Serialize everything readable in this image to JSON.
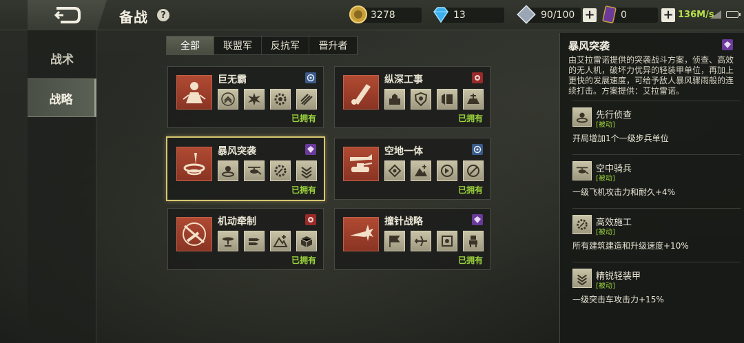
{
  "header": {
    "title": "备战",
    "help": "?",
    "resources": {
      "gold": "3278",
      "diamond": "13",
      "crystal": "90/100",
      "card": "0"
    },
    "net_speed": "136M/s"
  },
  "nav": {
    "items": [
      {
        "label": "战术",
        "active": false
      },
      {
        "label": "战略",
        "active": true
      }
    ]
  },
  "filters": [
    "全部",
    "联盟军",
    "反抗军",
    "晋升者"
  ],
  "owned_label": "已拥有",
  "cards": [
    {
      "name": "巨无霸",
      "faction": "alliance",
      "selected": false
    },
    {
      "name": "纵深工事",
      "faction": "rebel",
      "selected": false
    },
    {
      "name": "暴风突袭",
      "faction": "ascend",
      "selected": true
    },
    {
      "name": "空地一体",
      "faction": "alliance",
      "selected": false
    },
    {
      "name": "机动牵制",
      "faction": "rebel",
      "selected": false
    },
    {
      "name": "撞针战略",
      "faction": "ascend",
      "selected": false
    }
  ],
  "detail": {
    "title": "暴风突袭",
    "description": "由艾拉雷诺提供的突袭战斗方案，侦查、高效的无人机，破坏力优异的轻装甲单位，再加上更快的发展速度，可给予敌人暴风骤雨般的连续打击。方案提供：艾拉雷诺。",
    "skills": [
      {
        "name": "先行侦查",
        "tag": "[被动]",
        "desc": "开局增加1个一级步兵单位"
      },
      {
        "name": "空中骑兵",
        "tag": "[被动]",
        "desc": "一级飞机攻击力和耐久+4%"
      },
      {
        "name": "高效施工",
        "tag": "[被动]",
        "desc": "所有建筑建造和升级速度+10%"
      },
      {
        "name": "精锐轻装甲",
        "tag": "[被动]",
        "desc": "一级突击车攻击力+15%"
      }
    ]
  },
  "colors": {
    "owned": "#9bd43c",
    "portrait": "#b04a32",
    "selected_border": "#d8c870",
    "alliance": "#3a5a8a",
    "rebel": "#9a2a2a",
    "ascend": "#6a3a9a"
  }
}
